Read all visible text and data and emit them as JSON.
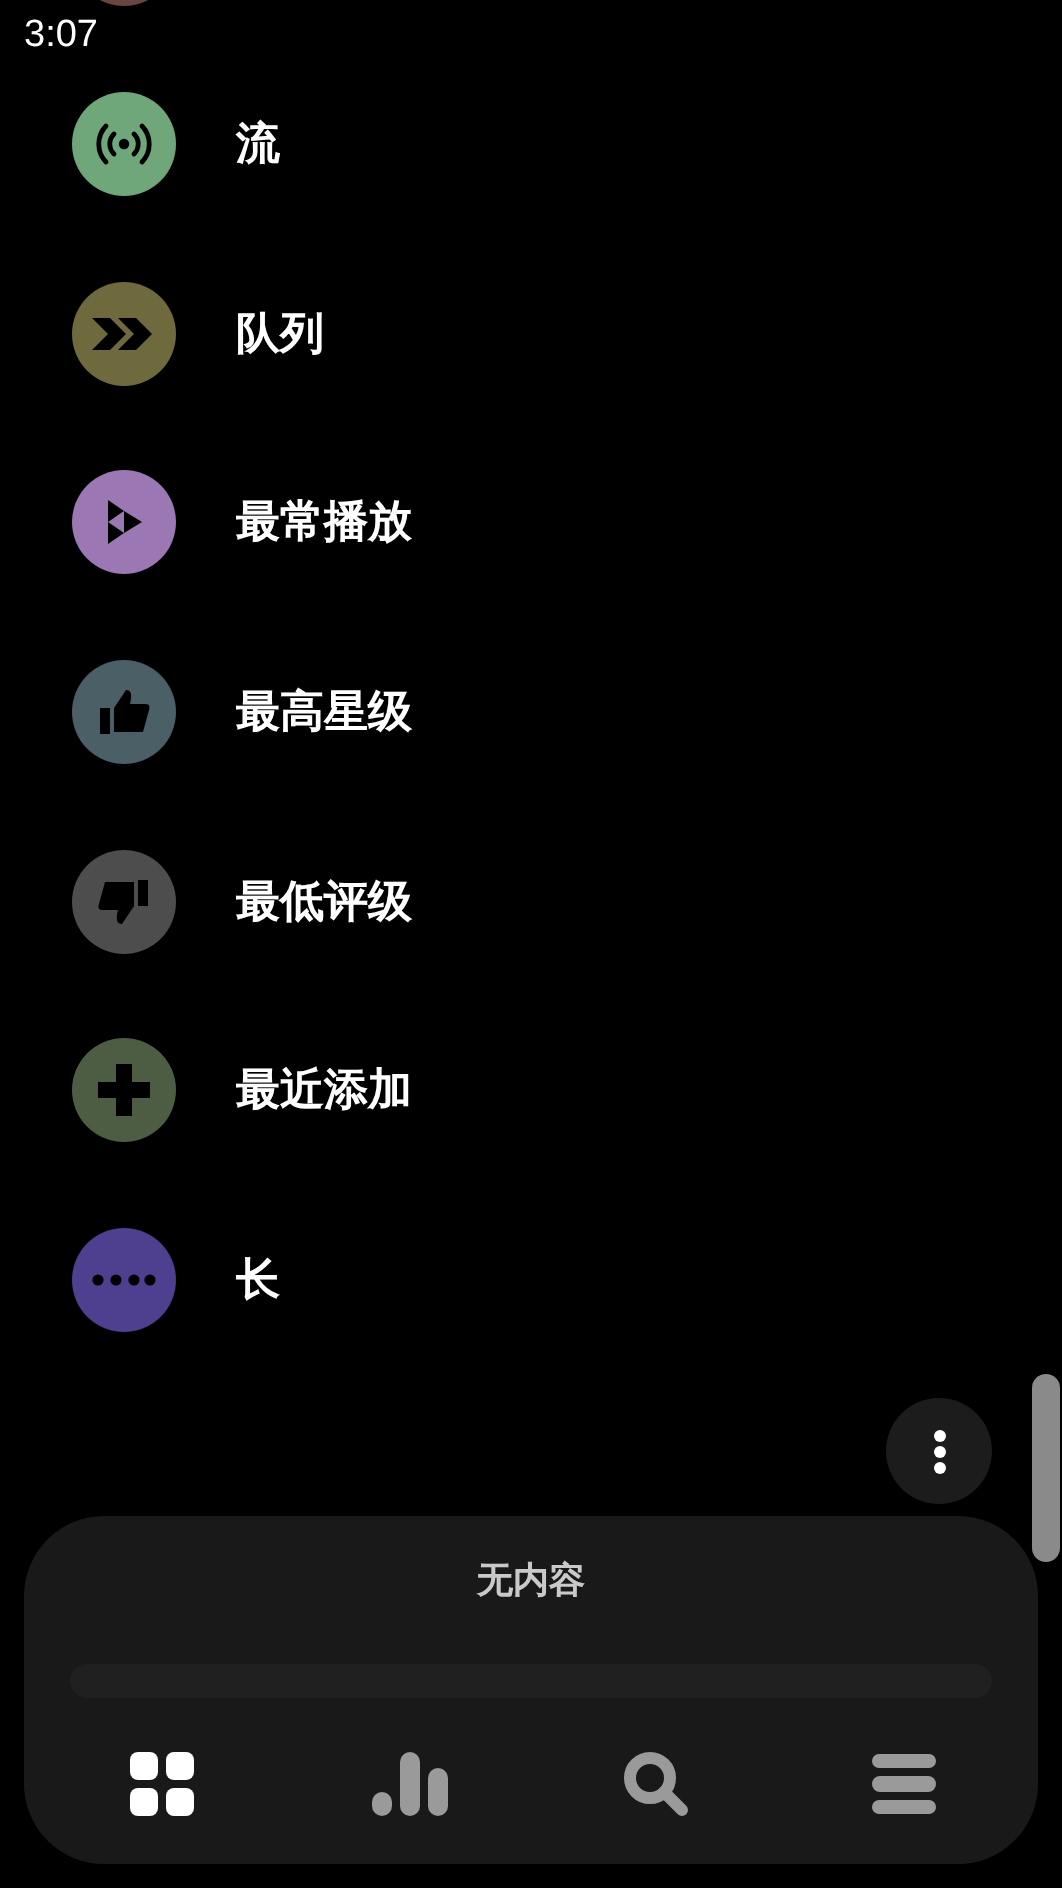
{
  "status_bar": {
    "time": "3:07"
  },
  "items": [
    {
      "kind": "cut",
      "color": "#6a4540"
    },
    {
      "kind": "stream",
      "label": "流",
      "color": "#6fa77a"
    },
    {
      "kind": "queue",
      "label": "队列",
      "color": "#6e6a3e"
    },
    {
      "kind": "played",
      "label": "最常播放",
      "color": "#9b78b3"
    },
    {
      "kind": "top",
      "label": "最高星级",
      "color": "#4a5f66"
    },
    {
      "kind": "low",
      "label": "最低评级",
      "color": "#4d4d4d"
    },
    {
      "kind": "recent",
      "label": "最近添加",
      "color": "#4d5d44"
    },
    {
      "kind": "long",
      "label": "长",
      "color": "#4e3f8f"
    }
  ],
  "now_playing": {
    "title": "无内容",
    "level": 0
  },
  "nav": [
    {
      "kind": "grid",
      "selected": true
    },
    {
      "kind": "stats",
      "selected": false
    },
    {
      "kind": "search",
      "selected": false
    },
    {
      "kind": "list",
      "selected": false
    }
  ]
}
